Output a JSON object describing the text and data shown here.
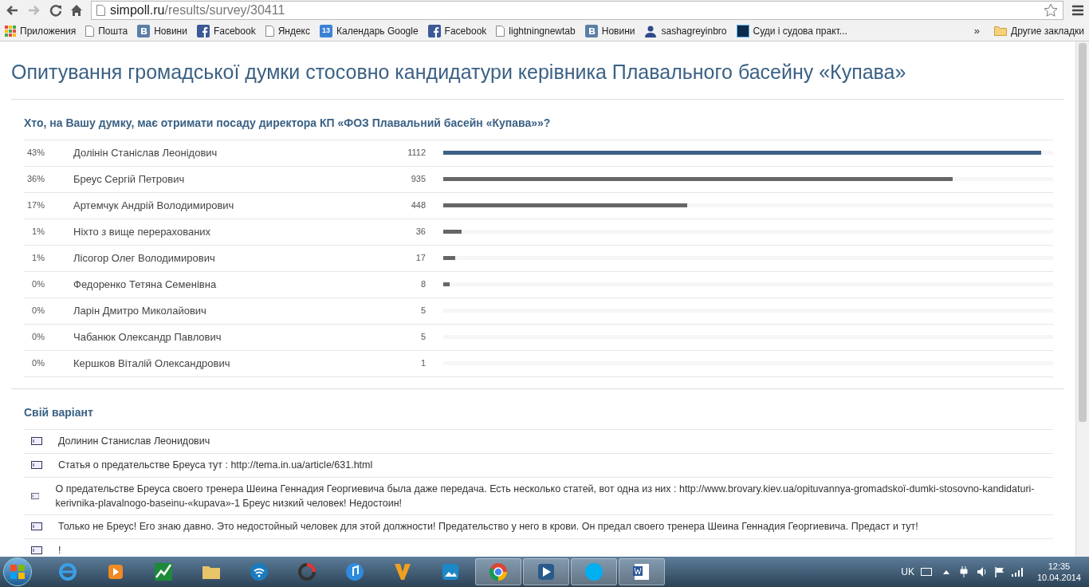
{
  "browser": {
    "url_host": "simpoll.ru",
    "url_path": "/results/survey/30411",
    "bookmarks": [
      {
        "kind": "apps",
        "label": "Приложения"
      },
      {
        "kind": "page",
        "label": "Пошта"
      },
      {
        "kind": "vk",
        "label": "Новини"
      },
      {
        "kind": "facebook",
        "label": "Facebook"
      },
      {
        "kind": "page",
        "label": "Яндекс"
      },
      {
        "kind": "calendar",
        "label": "Календарь Google",
        "icon_text": "13"
      },
      {
        "kind": "facebook",
        "label": "Facebook"
      },
      {
        "kind": "page",
        "label": "lightningnewtab"
      },
      {
        "kind": "vk",
        "label": "Новини"
      },
      {
        "kind": "user",
        "label": "sashagreyinbro"
      },
      {
        "kind": "ps",
        "label": "Суди і судова практ..."
      }
    ],
    "overflow": "»",
    "other_bookmarks": "Другие закладки"
  },
  "page": {
    "title": "Опитування громадської думки стосовно кандидатури керівника Плавального басейну «Купава»",
    "question": "Хто, на Вашу думку, має отримати посаду директора КП «ФОЗ Плавальний басейн «Купава»»?",
    "results": [
      {
        "percent": "43%",
        "name": "Долінін Станіслав Леонідович",
        "count": "1112",
        "level": 0.98,
        "color": "#3b6185"
      },
      {
        "percent": "36%",
        "name": "Бреус Сергій Петрович",
        "count": "935",
        "level": 0.835,
        "color": "#666666"
      },
      {
        "percent": "17%",
        "name": "Артемчук Андрій Володимирович",
        "count": "448",
        "level": 0.4,
        "color": "#666666"
      },
      {
        "percent": "1%",
        "name": "Ніхто з вище перерахованих",
        "count": "36",
        "level": 0.03,
        "color": "#666666"
      },
      {
        "percent": "1%",
        "name": "Лісогор Олег Володимирович",
        "count": "17",
        "level": 0.02,
        "color": "#666666"
      },
      {
        "percent": "0%",
        "name": "Федоренко Тетяна Семенівна",
        "count": "8",
        "level": 0.01,
        "color": "#666666"
      },
      {
        "percent": "0%",
        "name": "Ларін Дмитро Миколайович",
        "count": "5"
      },
      {
        "percent": "0%",
        "name": "Чабанюк Олександр Павлович",
        "count": "5"
      },
      {
        "percent": "0%",
        "name": "Кершков Віталій Олександрович",
        "count": "1"
      }
    ],
    "own_variant_title": "Свій варіант",
    "own_variants": [
      "Долинин Станислав Леонидович",
      "Статья о предательстве Бреуса тут : http://tema.in.ua/article/631.html",
      "О предательстве Бреуса своего тренера Шеина Геннадия Георгиевича была даже передача. Есть несколько статей, вот одна из них : http://www.brovary.kiev.ua/opituvannya-gromadskoї-dumki-stosovno-kandidaturi-kerivnika-plavalnogo-baseinu-«kupava»-1 Бреус низкий человек! Недостоин!",
      "Только не Бреус! Его знаю давно. Это недостойный человек для этой должности! Предательство у него в крови. Он предал своего тренера Шеина Геннадия Георгиевича. Предаст и тут!",
      "!"
    ]
  },
  "taskbar": {
    "apps": [
      {
        "kind": "ie",
        "active": false
      },
      {
        "kind": "player",
        "active": false
      },
      {
        "kind": "chart",
        "active": false
      },
      {
        "kind": "explorer",
        "active": false
      },
      {
        "kind": "wifi",
        "active": false
      },
      {
        "kind": "camera",
        "active": false
      },
      {
        "kind": "music",
        "active": false
      },
      {
        "kind": "v",
        "active": false
      },
      {
        "kind": "photos",
        "active": false
      },
      {
        "kind": "chrome",
        "active": true
      },
      {
        "kind": "play",
        "active": true
      },
      {
        "kind": "skype",
        "active": true
      },
      {
        "kind": "word",
        "active": true
      }
    ],
    "language": "UK",
    "time": "12:35",
    "date": "10.04.2014"
  }
}
